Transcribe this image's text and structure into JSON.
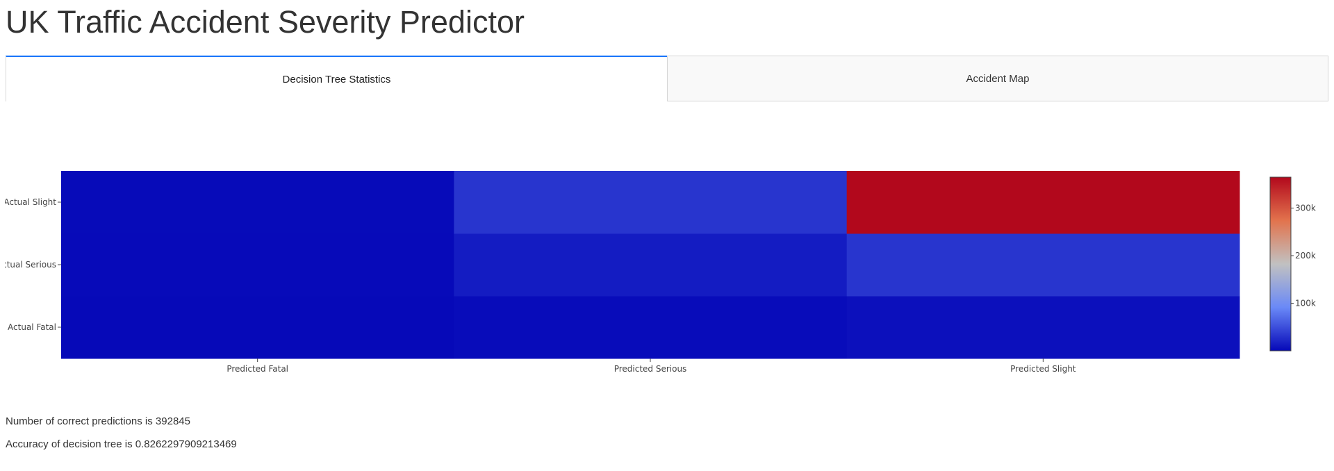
{
  "app": {
    "title": "UK Traffic Accident Severity Predictor"
  },
  "tabs": [
    {
      "label": "Decision Tree Statistics",
      "active": true
    },
    {
      "label": "Accident Map",
      "active": false
    }
  ],
  "chart_data": {
    "type": "heatmap",
    "x": [
      "Predicted Fatal",
      "Predicted Serious",
      "Predicted Slight"
    ],
    "y": [
      "Actual Fatal",
      "Actual Serious",
      "Actual Slight"
    ],
    "z": [
      [
        500,
        3000,
        6000
      ],
      [
        1500,
        14000,
        32000
      ],
      [
        2000,
        32000,
        365000
      ]
    ],
    "colorscale": [
      [
        0,
        "#0508b8"
      ],
      [
        0.25,
        "#6a89f7"
      ],
      [
        0.5,
        "#c1c1c1"
      ],
      [
        0.75,
        "#e2734d"
      ],
      [
        1,
        "#b2081c"
      ]
    ],
    "colorbar": {
      "tickvals": [
        100000,
        200000,
        300000
      ],
      "ticktext": [
        "100k",
        "200k",
        "300k"
      ],
      "zmin": 0,
      "zmax": 365000
    }
  },
  "stats": {
    "correct_predictions": "Number of correct predictions is 392845",
    "accuracy": "Accuracy of decision tree is 0.8262297909213469"
  }
}
